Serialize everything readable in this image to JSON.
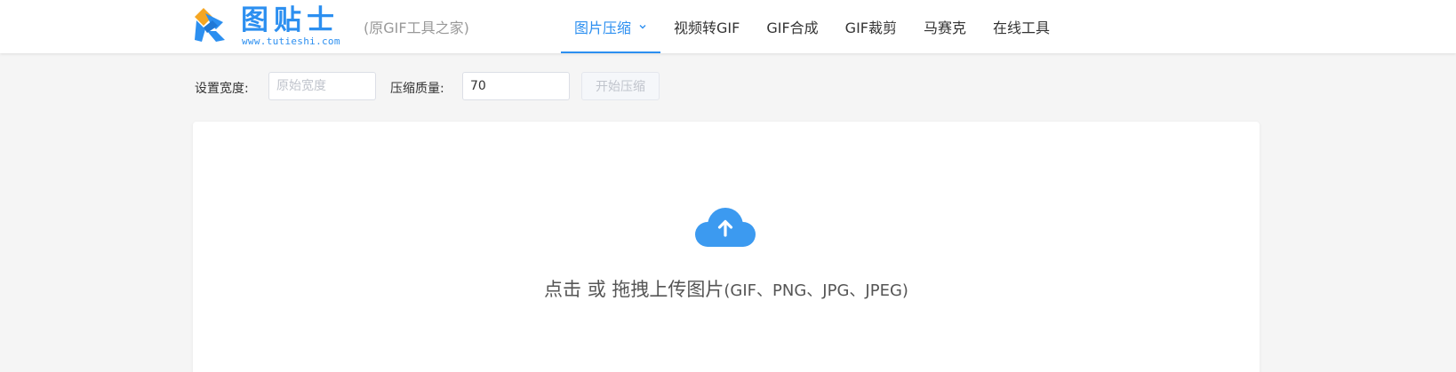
{
  "header": {
    "logo_text": "图贴士",
    "logo_url": "www.tutieshi.com",
    "slogan": "(原GIF工具之家)"
  },
  "nav": {
    "items": [
      {
        "label": "图片压缩",
        "active": true,
        "has_dropdown": true
      },
      {
        "label": "视频转GIF"
      },
      {
        "label": "GIF合成"
      },
      {
        "label": "GIF裁剪"
      },
      {
        "label": "马赛克"
      },
      {
        "label": "在线工具"
      }
    ]
  },
  "settings": {
    "width_label": "设置宽度:",
    "width_placeholder": "原始宽度",
    "quality_label": "压缩质量:",
    "quality_value": "70",
    "start_button": "开始压缩"
  },
  "upload": {
    "icon": "cloud-upload-icon",
    "main_text": "点击 或 拖拽上传图片",
    "formats_text": "(GIF、PNG、JPG、JPEG)"
  },
  "colors": {
    "accent": "#2c8ff0",
    "logo_orange": "#f5a623",
    "upload_icon": "#3c9af0"
  }
}
